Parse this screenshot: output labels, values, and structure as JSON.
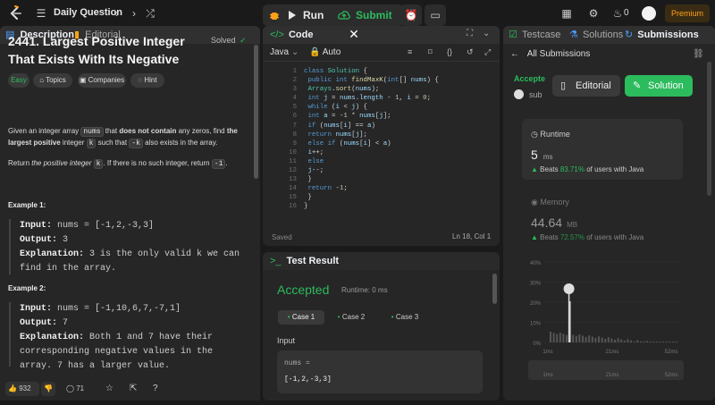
{
  "topbar": {
    "title": "Daily Question",
    "run_label": "Run",
    "submit_label": "Submit",
    "streak": "0",
    "premium_label": "Premium"
  },
  "description": {
    "tab_description": "Description",
    "tab_editorial": "Editorial",
    "title": "2441. Largest Positive Integer That Exists With Its Negative",
    "status": "Solved",
    "tags": [
      "Easy",
      "Topics",
      "Companies",
      "Hint"
    ],
    "p1_a": "Given an integer array ",
    "p1_code": "nums",
    "p1_b": " that ",
    "p1_bold1": "does not contain",
    "p1_c": " any zeros, find ",
    "p1_bold2": "the largest positive",
    "p1_d": " integer ",
    "p1_code2": "k",
    "p1_e": " such that ",
    "p1_code3": "-k",
    "p1_f": " also exists in the array.",
    "p2_a": "Return ",
    "p2_em": "the positive integer",
    "p2_b": " ",
    "p2_code": "k",
    "p2_c": ". If there is no such integer, return ",
    "p2_code2": "-1",
    "p2_d": ".",
    "example1_head": "Example 1:",
    "example1": {
      "input_label": "Input:",
      "input": " nums = [-1,2,-3,3]",
      "output_label": "Output:",
      "output": " 3",
      "expl_label": "Explanation:",
      "expl": " 3 is the only valid k we can find in the array."
    },
    "example2_head": "Example 2:",
    "example2": {
      "input_label": "Input:",
      "input": " nums = [-1,10,6,7,-7,1]",
      "output_label": "Output:",
      "output": " 7",
      "expl_label": "Explanation:",
      "expl": " Both 1 and 7 have their corresponding negative values in the array. 7 has a larger value."
    },
    "likes": "932",
    "comments": "71"
  },
  "code": {
    "tab": "Code",
    "language": "Java",
    "mode": "Auto",
    "status": "Saved",
    "cursor": "Ln 18, Col 1"
  },
  "test": {
    "tab": "Test Result",
    "verdict": "Accepted",
    "runtime": "Runtime: 0 ms",
    "cases": [
      "Case 1",
      "Case 2",
      "Case 3"
    ],
    "input_label": "Input",
    "var_name": "nums =",
    "var_value": "[-1,2,-3,3]"
  },
  "submissions": {
    "tab_testcase": "Testcase",
    "tab_solutions": "Solutions",
    "tab_submissions": "Submissions",
    "back_label": "All Submissions",
    "accepted": "Accepte",
    "user": "sub",
    "editorial_btn": "Editorial",
    "solution_btn": "Solution",
    "runtime_label": "Runtime",
    "runtime_value": "5",
    "runtime_unit": "ms",
    "runtime_beats_a": "Beats ",
    "runtime_beats_pct": "83.71%",
    "runtime_beats_b": " of users with Java",
    "memory_label": "Memory",
    "memory_value": "44.64",
    "memory_unit": "MB",
    "memory_beats_a": "Beats ",
    "memory_beats_pct": "72.57%",
    "memory_beats_b": " of users with Java",
    "y_ticks": [
      "40%",
      "30%",
      "20%",
      "10%",
      "0%"
    ],
    "x_ticks": [
      "1ms",
      "21ms",
      "52ms"
    ],
    "nav_ticks": [
      "1ms",
      "21ms",
      "52ms"
    ]
  },
  "colors": {
    "accent_green": "#2cbb5d",
    "accent_orange": "#ffa116",
    "bg": "#1a1a1a",
    "panel": "#262626"
  }
}
